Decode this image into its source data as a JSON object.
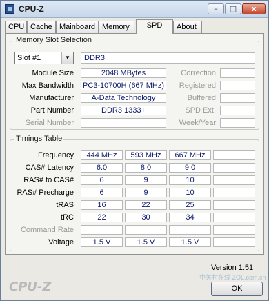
{
  "window": {
    "title": "CPU-Z",
    "controls": {
      "minimize": "–",
      "maximize": "□",
      "close": "x"
    }
  },
  "tabs": [
    {
      "label": "CPU"
    },
    {
      "label": "Cache"
    },
    {
      "label": "Mainboard"
    },
    {
      "label": "Memory"
    },
    {
      "label": "SPD",
      "active": true
    },
    {
      "label": "About"
    }
  ],
  "memory_slot": {
    "group_label": "Memory Slot Selection",
    "slot_value": "Slot #1",
    "memory_type": "DDR3",
    "fields": [
      {
        "label": "Module Size",
        "value": "2048 MBytes"
      },
      {
        "label": "Max Bandwidth",
        "value": "PC3-10700H (667 MHz)"
      },
      {
        "label": "Manufacturer",
        "value": "A-Data Technology"
      },
      {
        "label": "Part Number",
        "value": "DDR3 1333+"
      },
      {
        "label": "Serial Number",
        "value": ""
      }
    ],
    "right_fields": [
      {
        "label": "Correction",
        "value": ""
      },
      {
        "label": "Registered",
        "value": ""
      },
      {
        "label": "Buffered",
        "value": ""
      },
      {
        "label": "SPD Ext.",
        "value": ""
      },
      {
        "label": "Week/Year",
        "value": ""
      }
    ]
  },
  "timings": {
    "group_label": "Timings Table",
    "rows": [
      {
        "label": "Frequency",
        "values": [
          "444 MHz",
          "593 MHz",
          "667 MHz",
          ""
        ]
      },
      {
        "label": "CAS# Latency",
        "values": [
          "6.0",
          "8.0",
          "9.0",
          ""
        ]
      },
      {
        "label": "RAS# to CAS#",
        "values": [
          "6",
          "9",
          "10",
          ""
        ]
      },
      {
        "label": "RAS# Precharge",
        "values": [
          "6",
          "9",
          "10",
          ""
        ]
      },
      {
        "label": "tRAS",
        "values": [
          "16",
          "22",
          "25",
          ""
        ]
      },
      {
        "label": "tRC",
        "values": [
          "22",
          "30",
          "34",
          ""
        ]
      },
      {
        "label": "Command Rate",
        "values": [
          "",
          "",
          "",
          ""
        ]
      },
      {
        "label": "Voltage",
        "values": [
          "1.5 V",
          "1.5 V",
          "1.5 V",
          ""
        ]
      }
    ]
  },
  "footer": {
    "logo": "CPU-Z",
    "version": "Version 1.51",
    "ok_label": "OK",
    "watermark": "中关村在线 ZOL.com.cn"
  }
}
